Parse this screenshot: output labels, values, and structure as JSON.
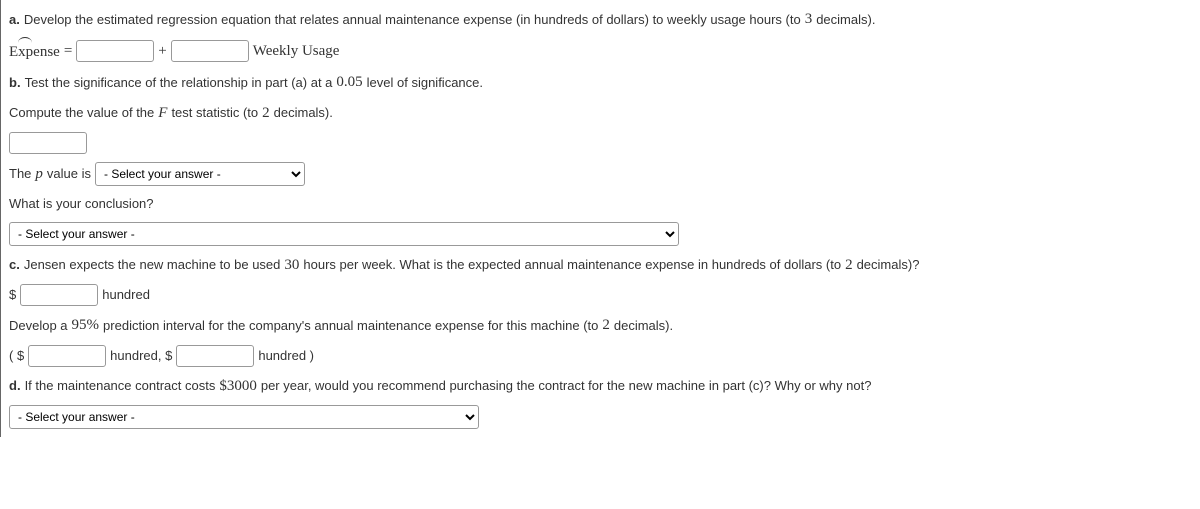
{
  "a": {
    "label": "a.",
    "text": "Develop the estimated regression equation that relates annual maintenance expense (in hundreds of dollars) to weekly usage hours (to",
    "decimals": "3",
    "tail": "decimals).",
    "expense": "Expense",
    "equals": "=",
    "plus": "+",
    "weekly_usage": "Weekly Usage"
  },
  "b": {
    "label": "b.",
    "text": "Test the significance of the relationship in part (a) at a",
    "alpha": "0.05",
    "tail": "level of significance.",
    "compute_text_pre": "Compute the value of the",
    "F": "F",
    "compute_text_post": "test statistic (to",
    "decimals": "2",
    "compute_tail": "decimals).",
    "p_pre": "The",
    "p": "p",
    "p_post": "value is",
    "select_placeholder": "- Select your answer -",
    "conclusion": "What is your conclusion?"
  },
  "c": {
    "label": "c.",
    "text_pre": "Jensen expects the new machine to be used",
    "hours": "30",
    "text_mid": "hours per week. What is the expected annual maintenance expense in hundreds of dollars (to",
    "decimals": "2",
    "text_tail": "decimals)?",
    "dollar": "$",
    "hundred": "hundred",
    "develop_pre": "Develop a",
    "pct": "95%",
    "develop_post": "prediction interval for the company's annual maintenance expense for this machine (to",
    "decimals2": "2",
    "develop_tail": "decimals).",
    "open": "( $",
    "comma": "hundred, $",
    "close": "hundred )"
  },
  "d": {
    "label": "d.",
    "text_pre": "If the maintenance contract costs",
    "cost": "$3000",
    "text_post": "per year, would you recommend purchasing the contract for the new machine in part (c)? Why or why not?",
    "select_placeholder": "- Select your answer -"
  }
}
